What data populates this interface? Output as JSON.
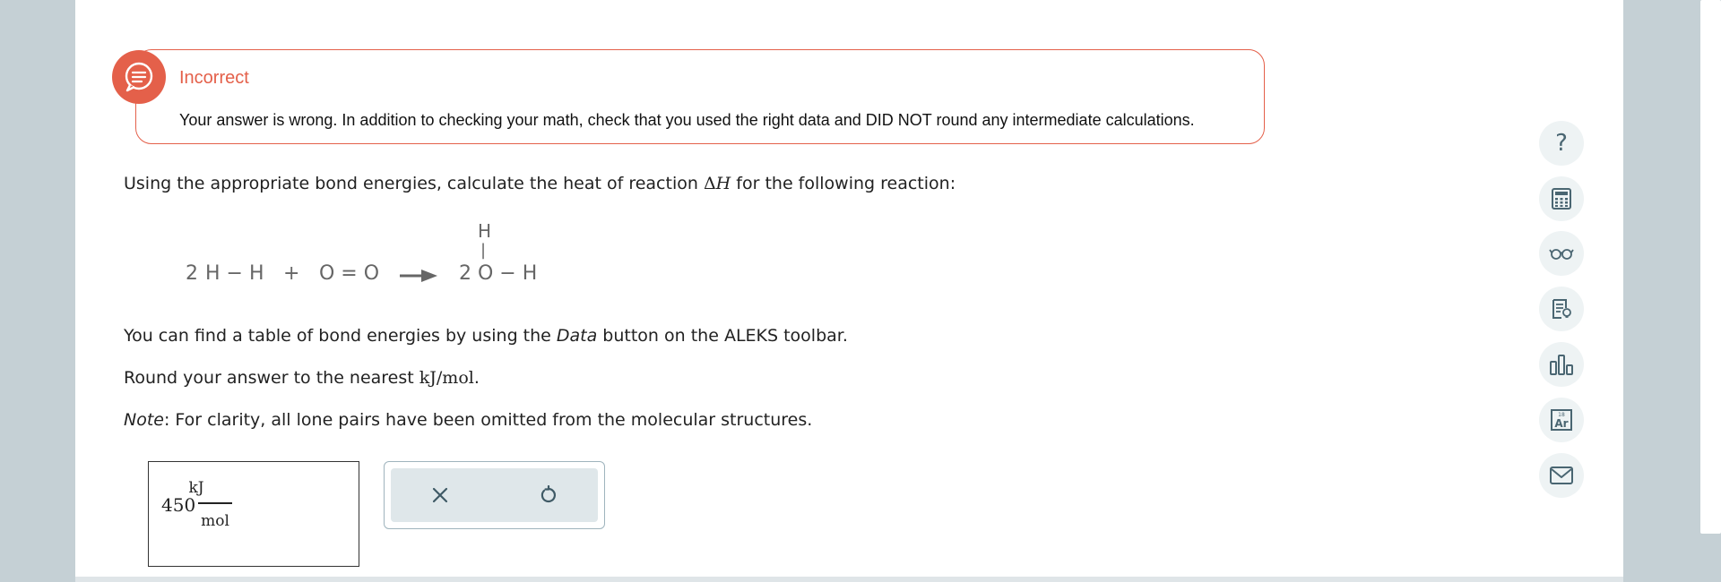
{
  "feedback": {
    "title": "Incorrect",
    "message": "Your answer is wrong. In addition to checking your math, check that you used the right data and DID NOT round any intermediate calculations."
  },
  "question": {
    "intro_before": "Using the appropriate bond energies, calculate the heat of reaction ",
    "delta_symbol": "Δ",
    "h_symbol": "H",
    "intro_after": " for the following reaction:",
    "data_line_before": "You can find a table of bond energies by using the ",
    "data_word": "Data",
    "data_line_after": " button on the ALEKS toolbar.",
    "round_before": "Round your answer to the nearest ",
    "round_unit": "kJ/mol",
    "round_after": ".",
    "note_label": "Note",
    "note_text": ": For clarity, all lone pairs have been omitted from the molecular structures."
  },
  "reaction": {
    "coef1": "2",
    "reactant1": "H − H",
    "plus": "+",
    "reactant2": "O = O",
    "coef2": "2",
    "product_top_atom": "H",
    "product_bond_vertical": "|",
    "product_main": "O − H"
  },
  "answer": {
    "value": "450",
    "unit_numerator": "kJ",
    "unit_denominator": "mol"
  },
  "colors": {
    "error_accent": "#e4604a",
    "toolbar_icon": "#4a6672"
  },
  "toolbar": {
    "help_glyph": "?",
    "periodic_mass": "18",
    "periodic_symbol": "Ar"
  }
}
